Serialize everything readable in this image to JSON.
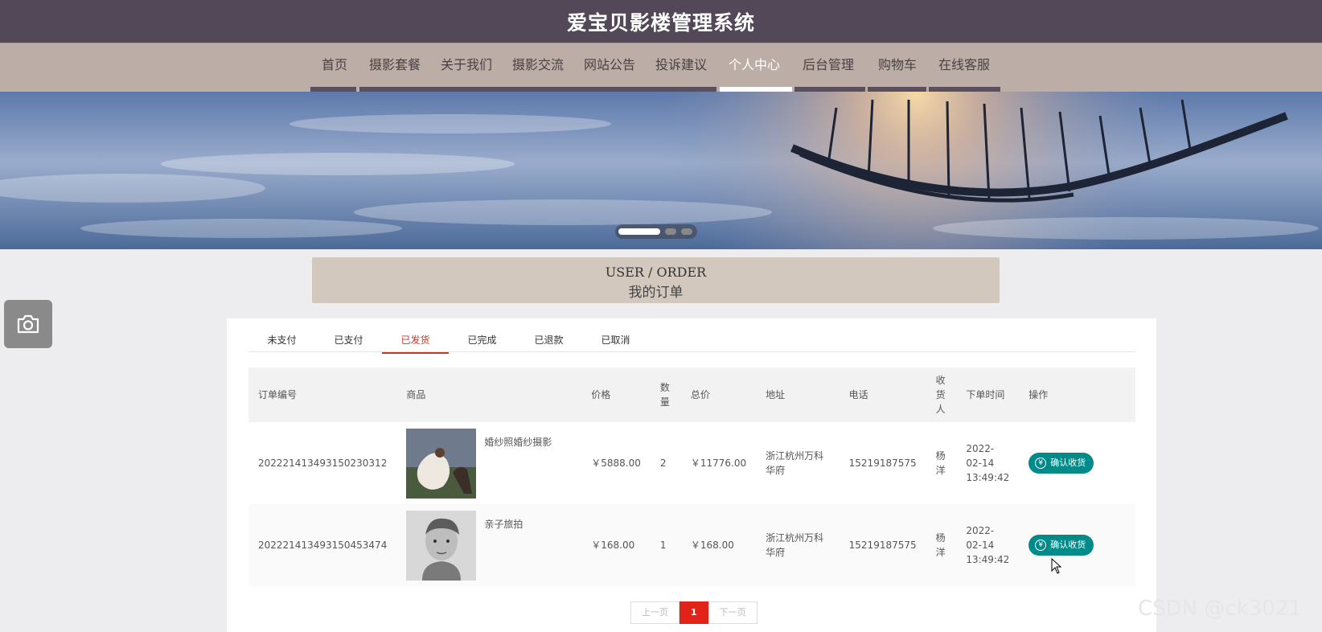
{
  "app": {
    "title": "爱宝贝影楼管理系统"
  },
  "nav": {
    "items": [
      "首页",
      "摄影套餐",
      "关于我们",
      "摄影交流",
      "网站公告",
      "投诉建议",
      "个人中心",
      "后台管理",
      "购物车",
      "在线客服"
    ],
    "active": "个人中心"
  },
  "banner": {
    "slides": 3,
    "active_slide": 1
  },
  "heading": {
    "en": "USER / ORDER",
    "zh": "我的订单"
  },
  "tabs": {
    "items": [
      "未支付",
      "已支付",
      "已发货",
      "已完成",
      "已退款",
      "已取消"
    ],
    "active": "已发货"
  },
  "table": {
    "headers": {
      "order_no": "订单编号",
      "product": "商品",
      "price": "价格",
      "qty": "数量",
      "total": "总价",
      "address": "地址",
      "phone": "电话",
      "receiver": "收货人",
      "time": "下单时间",
      "action": "操作"
    },
    "rows": [
      {
        "order_no": "20222141349315023031​2",
        "product": "婚纱照婚纱摄影",
        "price": "￥5888.00",
        "qty": "2",
        "total": "￥11776.00",
        "address": "浙江杭州万科华府",
        "phone": "15219187575",
        "receiver": "杨洋",
        "time": "2022-02-14 13:49:42",
        "action": "确认收货"
      },
      {
        "order_no": "202221413493150453474",
        "product": "亲子旅拍",
        "price": "￥168.00",
        "qty": "1",
        "total": "￥168.00",
        "address": "浙江杭州万科华府",
        "phone": "15219187575",
        "receiver": "杨洋",
        "time": "2022-02-14 13:49:42",
        "action": "确认收货"
      }
    ]
  },
  "pager": {
    "prev": "上一页",
    "current": "1",
    "next": "下一页"
  },
  "watermark": "CSDN @ck3021",
  "colors": {
    "header": "#524858",
    "nav": "#bcaea6",
    "accent": "#c0392b",
    "button": "#008b8b"
  }
}
